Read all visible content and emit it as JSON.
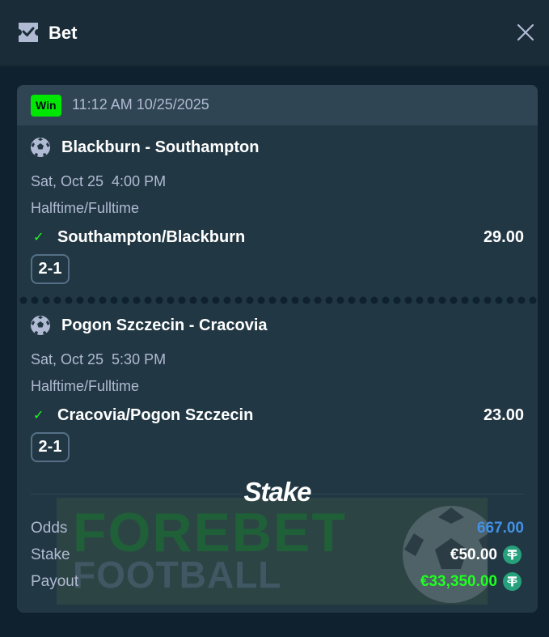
{
  "header": {
    "title": "Bet",
    "icon": "ticket-icon",
    "close_icon": "close-icon"
  },
  "bet": {
    "status": "Win",
    "timestamp": "11:12 AM 10/25/2025",
    "legs": [
      {
        "match": "Blackburn - Southampton",
        "date": "Sat, Oct 25  4:00 PM",
        "market": "Halftime/Fulltime",
        "selection": "Southampton/Blackburn",
        "odds": "29.00",
        "score": "2-1",
        "sport_icon": "soccer-ball-icon"
      },
      {
        "match": "Pogon Szczecin - Cracovia",
        "date": "Sat, Oct 25  5:30 PM",
        "market": "Halftime/Fulltime",
        "selection": "Cracovia/Pogon Szczecin",
        "odds": "23.00",
        "score": "2-1",
        "sport_icon": "soccer-ball-icon"
      }
    ],
    "brand": "Stake",
    "watermark": {
      "line1": "FOREBET",
      "line2": "FOOTBALL"
    },
    "summary": {
      "odds_label": "Odds",
      "odds_value": "667.00",
      "stake_label": "Stake",
      "stake_value": "€50.00",
      "payout_label": "Payout",
      "payout_value": "€33,350.00",
      "currency_icon": "tether-icon"
    }
  },
  "colors": {
    "page_bg": "#0f212e",
    "header_bg": "#1a2c38",
    "card_bg": "#213743",
    "card_head_bg": "#2f4553",
    "win_green": "#00e701",
    "odds_blue": "#4391e7",
    "payout_green": "#1fff20",
    "muted_text": "#b1bad3",
    "tether_green": "#26a17b"
  }
}
